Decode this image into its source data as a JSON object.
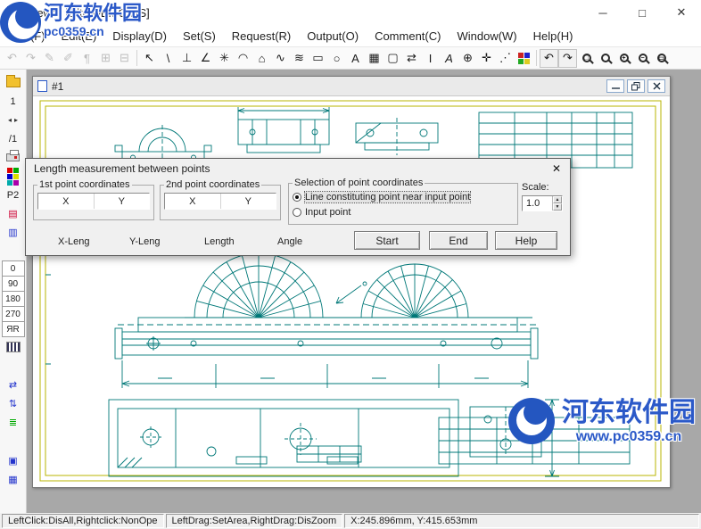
{
  "window": {
    "title": "Viewer [Dito DEMO HS]",
    "controls": {
      "minimize": "─",
      "maximize": "□",
      "close": "✕"
    }
  },
  "menu": {
    "items": [
      {
        "id": "file",
        "label": "File(F)"
      },
      {
        "id": "edit",
        "label": "Edit(E)"
      },
      {
        "id": "display",
        "label": "Display(D)"
      },
      {
        "id": "set",
        "label": "Set(S)"
      },
      {
        "id": "request",
        "label": "Request(R)"
      },
      {
        "id": "output",
        "label": "Output(O)"
      },
      {
        "id": "comment",
        "label": "Comment(C)"
      },
      {
        "id": "window",
        "label": "Window(W)"
      },
      {
        "id": "help",
        "label": "Help(H)"
      }
    ]
  },
  "toolbar": {
    "groups": [
      {
        "items": [
          {
            "name": "prev-view-icon",
            "glyph": "↶",
            "disabled": true
          },
          {
            "name": "next-view-icon",
            "glyph": "↷",
            "disabled": true
          },
          {
            "name": "pencil-icon",
            "glyph": "✎",
            "disabled": true
          },
          {
            "name": "pen-icon",
            "glyph": "✐",
            "disabled": true
          },
          {
            "name": "pilcrow-icon",
            "glyph": "¶",
            "disabled": true
          },
          {
            "name": "copy-icon",
            "glyph": "⊞",
            "disabled": true
          },
          {
            "name": "paste-icon",
            "glyph": "⊟",
            "disabled": true
          }
        ]
      },
      {
        "items": [
          {
            "name": "pointer-icon",
            "glyph": "↖"
          },
          {
            "name": "line-icon",
            "glyph": "\\"
          },
          {
            "name": "perpendicular-icon",
            "glyph": "⊥"
          },
          {
            "name": "angle-icon",
            "glyph": "∠"
          },
          {
            "name": "point-star-icon",
            "glyph": "✳"
          },
          {
            "name": "arc-icon",
            "glyph": "◠"
          },
          {
            "name": "polygon-icon",
            "glyph": "⌂"
          },
          {
            "name": "spline-icon",
            "glyph": "∿"
          },
          {
            "name": "offset-icon",
            "glyph": "≋"
          },
          {
            "name": "rectangle-icon",
            "glyph": "▭"
          },
          {
            "name": "ellipse-icon",
            "glyph": "○"
          },
          {
            "name": "text-icon",
            "glyph": "A"
          },
          {
            "name": "hatch-icon",
            "glyph": "▦"
          },
          {
            "name": "dotted-rect-icon",
            "glyph": "▢"
          },
          {
            "name": "swap-arrows-icon",
            "glyph": "⇄"
          },
          {
            "name": "ibeam-icon",
            "glyph": "I"
          },
          {
            "name": "slant-text-icon",
            "glyph": "A",
            "italic": true
          },
          {
            "name": "crosshair-icon",
            "glyph": "⊕"
          },
          {
            "name": "cross-plus-icon",
            "glyph": "✛"
          },
          {
            "name": "measure-dots-icon",
            "glyph": "⋰"
          },
          {
            "name": "palette-icon",
            "kind": "palette",
            "colors": [
              "#c22",
              "#22c",
              "#2a2",
              "#dc2"
            ]
          }
        ]
      },
      {
        "items": [
          {
            "name": "undo-view-icon",
            "glyph": "↶",
            "boxed": true
          },
          {
            "name": "redo-view-icon",
            "glyph": "↷",
            "boxed": true
          },
          {
            "name": "zoom-window-icon",
            "kind": "magnifier",
            "sign": "□"
          },
          {
            "name": "zoom-icon",
            "kind": "magnifier",
            "sign": ""
          },
          {
            "name": "zoom-in-icon",
            "kind": "magnifier",
            "sign": "+"
          },
          {
            "name": "zoom-out-icon",
            "kind": "magnifier",
            "sign": "−"
          },
          {
            "name": "zoom-fit-icon",
            "kind": "magnifier",
            "sign": "▭"
          }
        ]
      }
    ]
  },
  "sidebar": {
    "items": [
      {
        "name": "open-folder-button",
        "kind": "folder"
      },
      {
        "name": "sheet-number-label",
        "kind": "text",
        "text": "1",
        "interactable": false
      },
      {
        "name": "sheet-nav",
        "kind": "pair",
        "left": "◂",
        "right": "▸",
        "left_name": "prev-sheet-icon",
        "right_name": "next-sheet-icon"
      },
      {
        "name": "sheet-total-label",
        "kind": "text",
        "text": "/1",
        "interactable": false
      },
      {
        "name": "print-button",
        "kind": "printer"
      },
      {
        "name": "palette-button",
        "kind": "palette",
        "colors": [
          "#d00",
          "#0a0",
          "#00c",
          "#dd0",
          "#0aa",
          "#a0a"
        ]
      },
      {
        "name": "page-label",
        "kind": "text",
        "text": "P2",
        "interactable": false
      },
      {
        "name": "layers-red-button",
        "kind": "glyph",
        "glyph": "▤",
        "color": "#c03"
      },
      {
        "name": "layers-blue-button",
        "kind": "glyph",
        "glyph": "▥",
        "color": "#23c"
      },
      {
        "name": "sidebar-gap-1",
        "kind": "gap"
      },
      {
        "name": "rotate-0-button",
        "kind": "cell",
        "text": "0"
      },
      {
        "name": "rotate-90-button",
        "kind": "cell",
        "text": "90"
      },
      {
        "name": "rotate-180-button",
        "kind": "cell",
        "text": "180"
      },
      {
        "name": "rotate-270-button",
        "kind": "cell",
        "text": "270"
      },
      {
        "name": "mirror-button",
        "kind": "cell",
        "text": "ЯR"
      },
      {
        "name": "stripes-button",
        "kind": "stripes"
      },
      {
        "name": "sidebar-gap-2",
        "kind": "gap"
      },
      {
        "name": "h-flip-button",
        "kind": "glyph",
        "glyph": "⇄",
        "color": "#23c"
      },
      {
        "name": "v-flip-button",
        "kind": "glyph",
        "glyph": "⇅",
        "color": "#23c"
      },
      {
        "name": "list-button",
        "kind": "glyph",
        "glyph": "≣",
        "color": "#0a0"
      },
      {
        "name": "sidebar-gap-3",
        "kind": "gap"
      },
      {
        "name": "window-1-button",
        "kind": "glyph",
        "glyph": "▣",
        "color": "#23c"
      },
      {
        "name": "window-grid-button",
        "kind": "glyph",
        "glyph": "▦",
        "color": "#23c"
      }
    ]
  },
  "child_window": {
    "title": "#1"
  },
  "dialog": {
    "title": "Length measurement between points",
    "close_glyph": "✕",
    "first_point": {
      "title": "1st point coordinates",
      "x_label": "X",
      "y_label": "Y"
    },
    "second_point": {
      "title": "2nd point coordinates",
      "x_label": "X",
      "y_label": "Y"
    },
    "selection": {
      "title": "Selection of point coordinates",
      "options": [
        {
          "label": "Line constituting point near input point",
          "selected": true
        },
        {
          "label": "Input point",
          "selected": false
        }
      ]
    },
    "scale": {
      "label": "Scale:",
      "value": "1.0",
      "up_glyph": "▲",
      "down_glyph": "▼"
    },
    "result_labels": [
      "X-Leng",
      "Y-Leng",
      "Length",
      "Angle"
    ],
    "buttons": [
      {
        "id": "start",
        "label": "Start"
      },
      {
        "id": "end",
        "label": "End"
      },
      {
        "id": "help",
        "label": "Help"
      }
    ]
  },
  "statusbar": {
    "left": "LeftClick:DisAll,Rightclick:NonOpe",
    "middle": "LeftDrag:SetArea,RightDrag:DisZoom",
    "right": "X:245.896mm, Y:415.653mm"
  },
  "watermarks": {
    "top": {
      "site": "河东软件园",
      "url": "pc0359.cn"
    },
    "bottom": {
      "site": "河东软件园",
      "url": "www.pc0359.cn"
    }
  },
  "colors": {
    "drawing_line": "#007878",
    "sheet_border": "#b9b400",
    "watermark_blue": "#2b59c8"
  }
}
